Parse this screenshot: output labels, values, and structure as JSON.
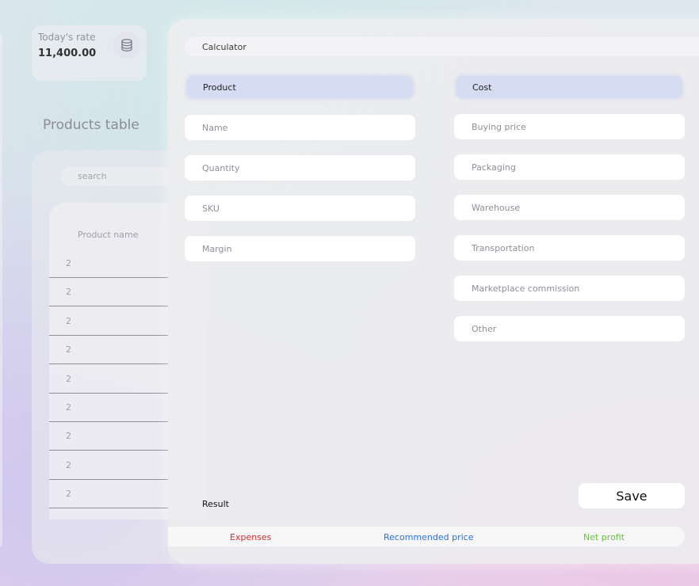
{
  "rate": {
    "title": "Today's rate",
    "value": "11,400.00"
  },
  "products": {
    "title": "Products table",
    "search_placeholder": "search",
    "column_header": "Product name",
    "rows": [
      "2",
      "2",
      "2",
      "2",
      "2",
      "2",
      "2",
      "2",
      "2"
    ]
  },
  "calculator": {
    "title": "Calculator",
    "product_section": {
      "label": "Product",
      "fields": [
        "Name",
        "Quantity",
        "SKU",
        "Margin"
      ]
    },
    "cost_section": {
      "label": "Cost",
      "fields": [
        "Buying price",
        "Packaging",
        "Warehouse",
        "Transportation",
        "Marketplace commission",
        "Other"
      ]
    },
    "result_label": "Result",
    "save_label": "Save",
    "results": {
      "expenses": "Expenses",
      "recommended_price": "Recommended price",
      "net_profit": "Net profit"
    }
  },
  "colors": {
    "expenses": "#d92b2b",
    "recommended_price": "#2b6fd9",
    "net_profit": "#6abf3f",
    "section_head": "#d6dcf2"
  },
  "icons": {
    "rate_card": "database-icon"
  }
}
